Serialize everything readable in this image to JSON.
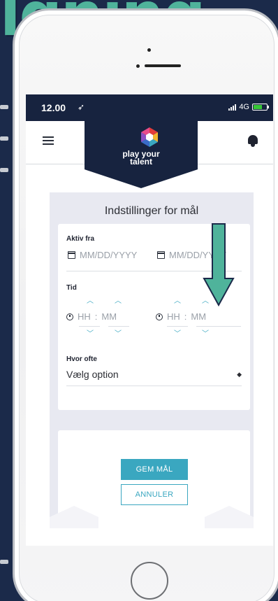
{
  "background": {
    "title_fragment": "lgning"
  },
  "status_bar": {
    "time": "12.00",
    "network": "4G"
  },
  "app_bar": {
    "brand_line1": "play your",
    "brand_line2": "talent"
  },
  "goal_settings": {
    "title": "Indstillinger for mål",
    "active_from": {
      "label": "Aktiv fra",
      "start_placeholder": "MM/DD/YYYY",
      "end_placeholder": "MM/DD/YYYY"
    },
    "time": {
      "label": "Tid",
      "hour_placeholder": "HH",
      "minute_placeholder": "MM",
      "separator": ":"
    },
    "frequency": {
      "label": "Hvor ofte",
      "selected": "Vælg option"
    },
    "save_label": "GEM MÅL",
    "cancel_label": "ANNULER"
  },
  "colors": {
    "accent": "#3aa7c0",
    "navy": "#17233f",
    "overlay_arrow": "#4fb39b"
  }
}
